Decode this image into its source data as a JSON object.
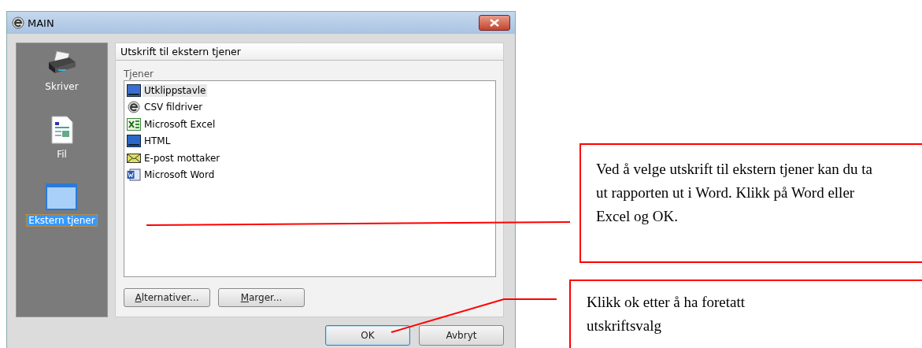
{
  "window": {
    "title": "MAIN"
  },
  "sidebar": {
    "items": [
      {
        "label": "Skriver",
        "kind": "printer",
        "selected": false
      },
      {
        "label": "Fil",
        "kind": "file",
        "selected": false
      },
      {
        "label": "Ekstern tjener",
        "kind": "external",
        "selected": true
      }
    ]
  },
  "panel": {
    "title": "Utskrift til ekstern tjener",
    "list_label": "Tjener",
    "servers": [
      {
        "label": "Utklippstavle",
        "kind": "clipboard",
        "selected": true
      },
      {
        "label": "CSV fildriver",
        "kind": "csv",
        "selected": false
      },
      {
        "label": "Microsoft Excel",
        "kind": "excel",
        "selected": false
      },
      {
        "label": "HTML",
        "kind": "html",
        "selected": false
      },
      {
        "label": "E-post mottaker",
        "kind": "mail",
        "selected": false
      },
      {
        "label": "Microsoft Word",
        "kind": "word",
        "selected": false
      }
    ],
    "buttons": [
      "Alternativer...",
      "Marger..."
    ]
  },
  "footer_buttons": [
    {
      "label": "OK",
      "default": true
    },
    {
      "label": "Avbryt",
      "default": false
    }
  ],
  "callouts": [
    {
      "text": "Ved å velge utskrift til ekstern tjener kan du ta ut rapporten ut i Word. Klikk på Word eller Excel og OK."
    },
    {
      "text": "Klikk ok etter å ha foretatt utskriftsvalg"
    }
  ]
}
